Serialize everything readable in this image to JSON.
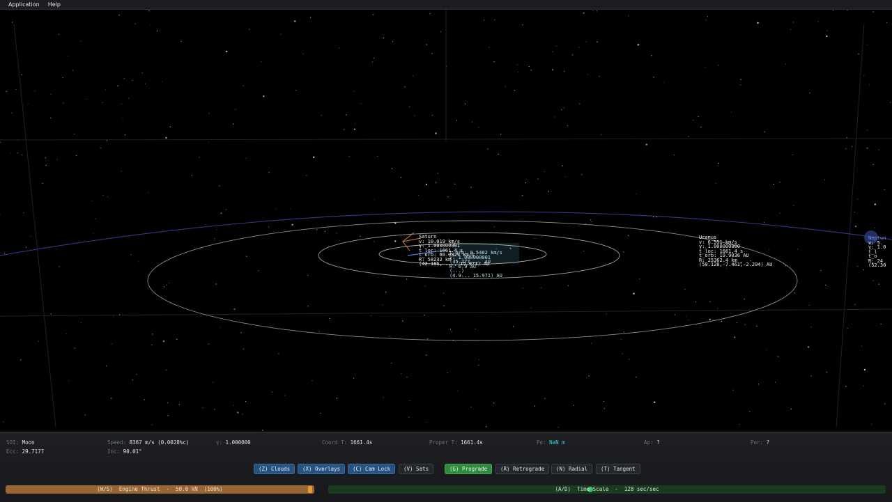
{
  "menu": {
    "items": [
      "Application",
      "Help"
    ]
  },
  "bodies": {
    "saturn": {
      "lines": [
        "Saturn",
        "v: 10.019 km/s",
        "γ: 1.000000001",
        "t_loc: 1661.4 s",
        "t_orb: 60.0829 km/s",
        "R: 58232 km",
        "(42.186, ..., 15.971) AU"
      ]
    },
    "uranus": {
      "lines": [
        "Uranus",
        "v: 6.551 km/s",
        "γ: 1.000000000",
        "t_loc: 1661.4 s",
        "t_orb: 19.9036 AU",
        "R: 25362.4 km",
        "(50.128,-7.461,-2.294) AU"
      ]
    },
    "neptune": {
      "lines": [
        "Neptun",
        "v: 5.",
        "γ: 1.0",
        "t_l",
        "t_o",
        "R: 24",
        "(52.30"
      ]
    },
    "cluster": {
      "lines": [
        "t_orb: 9.5402 km/s",
        "γ: 1.000000001",
        "(35.777,... AU",
        "R: 6.9 au",
        "(...)",
        "(4.9... 15.971) AU"
      ]
    }
  },
  "hud": {
    "soi": {
      "label": "SOI:",
      "value": "Moon"
    },
    "ecc": {
      "label": "Ecc:",
      "value": "29.7177"
    },
    "speed": {
      "label": "Speed:",
      "value": "8367 m/s (0.0028%c)"
    },
    "inc": {
      "label": "Inc:",
      "value": "90.01°"
    },
    "gamma": {
      "label": "γ:",
      "value": "1.000000"
    },
    "coord_t": {
      "label": "Coord T:",
      "value": "1661.4s"
    },
    "proper_t": {
      "label": "Proper T:",
      "value": "1661.4s"
    },
    "pe": {
      "label": "Pe:",
      "value": "NaN m"
    },
    "ap": {
      "label": "Ap:",
      "value": "?"
    },
    "per": {
      "label": "Per:",
      "value": "?"
    }
  },
  "toggles": [
    {
      "label": "(Z) Clouds",
      "state": "on"
    },
    {
      "label": "(X) Overlays",
      "state": "on"
    },
    {
      "label": "(C) Cam Lock",
      "state": "on"
    },
    {
      "label": "(V) Sats",
      "state": "off"
    },
    {
      "label": "(G) Prograde",
      "state": "active"
    },
    {
      "label": "(R) Retrograde",
      "state": "off"
    },
    {
      "label": "(N) Radial",
      "state": "off"
    },
    {
      "label": "(T) Tangent",
      "state": "off"
    }
  ],
  "thrust": {
    "label": "(W/S)  Engine Thrust  -  50.0 kN  (100%)",
    "fraction": 1.0
  },
  "timescale": {
    "label": "(A/D)  Time Scale  -  128 sec/sec",
    "fraction": 0.47
  },
  "colors": {
    "accent_blue": "#27517e",
    "accent_green": "#2f8a3f",
    "thrust": "#9a6634",
    "orbit": "#cfcfcf"
  }
}
